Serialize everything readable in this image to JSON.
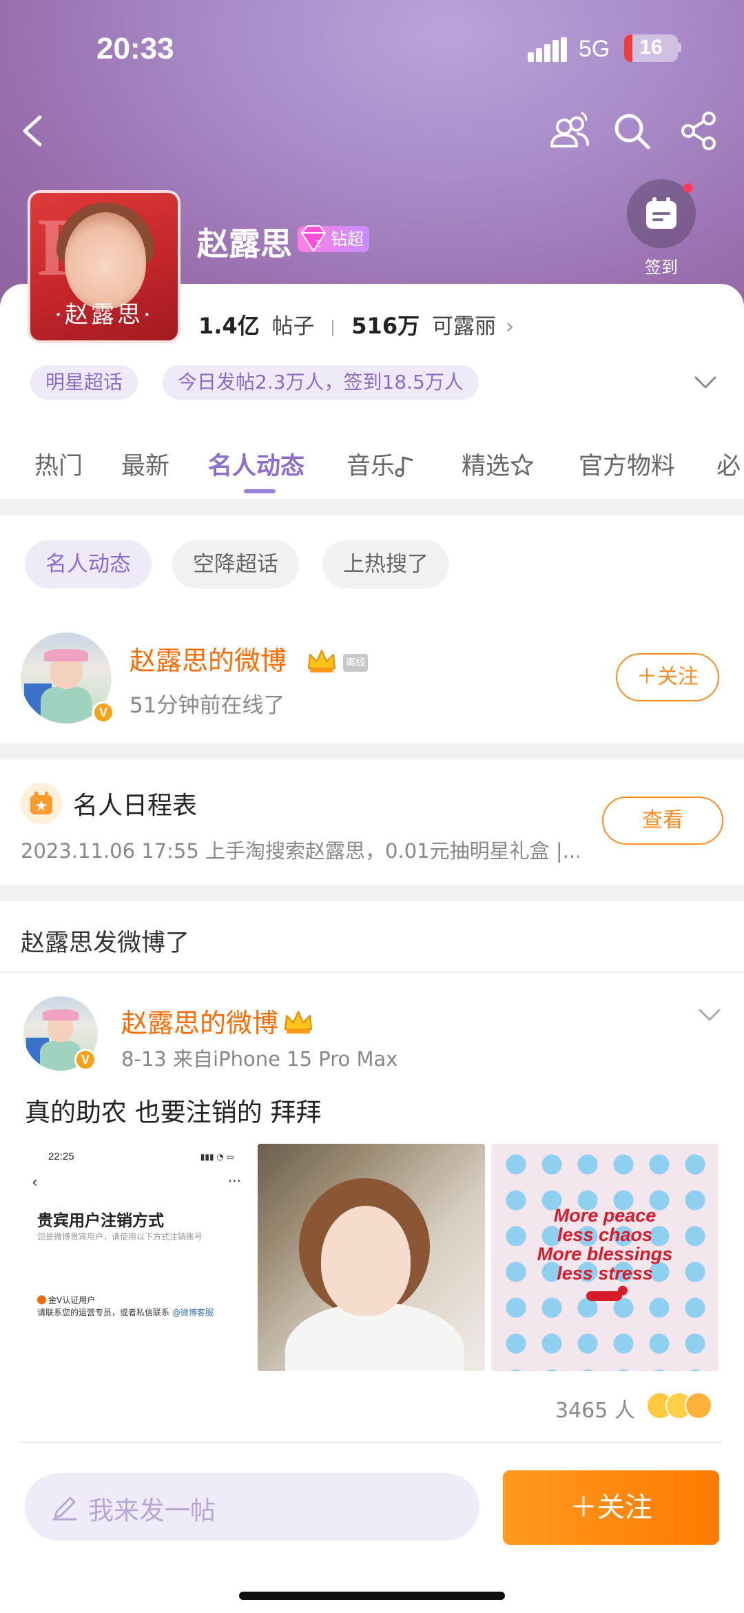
{
  "status_bar": {
    "time": "20:33",
    "network": "5G",
    "battery": "16",
    "battery_level": 0.16
  },
  "header": {
    "icons": [
      "back-icon",
      "friends-icon",
      "search-icon",
      "share-icon"
    ]
  },
  "checkin": {
    "label": "签到",
    "icon": "calendar-icon"
  },
  "topic": {
    "title": "赵露思",
    "cover_caption": "·赵露思·",
    "badge_level": "2",
    "badge_label": "钻超",
    "posts_count": "1.4亿",
    "posts_label": "帖子",
    "fans_count": "516万",
    "fans_label": "可露丽"
  },
  "chips": [
    "明星超话",
    "今日发帖2.3万人，签到18.5万人"
  ],
  "tabs": [
    "热门",
    "最新",
    "名人动态",
    "音乐",
    "精选",
    "官方物料",
    "必"
  ],
  "active_tab": "名人动态",
  "filters": [
    "名人动态",
    "空降超话",
    "上热搜了"
  ],
  "celebrity": {
    "name": "赵露思的微博",
    "offline_tag": "离线",
    "status": "51分钟前在线了",
    "follow_label": "＋关注",
    "verified": "V"
  },
  "schedule": {
    "title": "名人日程表",
    "line": "2023.11.06 17:55 上手淘搜索赵露思，0.01元抽明星礼盒 |...",
    "view_label": "查看"
  },
  "feed": {
    "header": "赵露思发微博了",
    "post": {
      "author": "赵露思的微博",
      "meta": "8-13  来自iPhone 15 Pro Max",
      "text": "真的助农 也要注销的 拜拜",
      "likes": "3465 人",
      "images": [
        {
          "type": "screenshot",
          "time": "22:25",
          "title": "贵宾用户注销方式",
          "subtitle": "您是微博贵宾用户，请使用以下方式注销账号",
          "tag": "金V认证用户",
          "line_a": "请联系您的运营专员，或者私信联系 ",
          "link": "@微博客服"
        },
        {
          "type": "photo",
          "desc": "selfie"
        },
        {
          "type": "quote",
          "lines": [
            "More peace",
            "less chaos",
            "More blessings",
            "less stress"
          ]
        }
      ]
    }
  },
  "bottom_bar": {
    "compose_placeholder": "我来发一帖",
    "follow_label": "＋关注"
  },
  "colors": {
    "accent": "#8c6ccc",
    "orange": "#ff7a00",
    "name_orange": "#ff6a00"
  }
}
